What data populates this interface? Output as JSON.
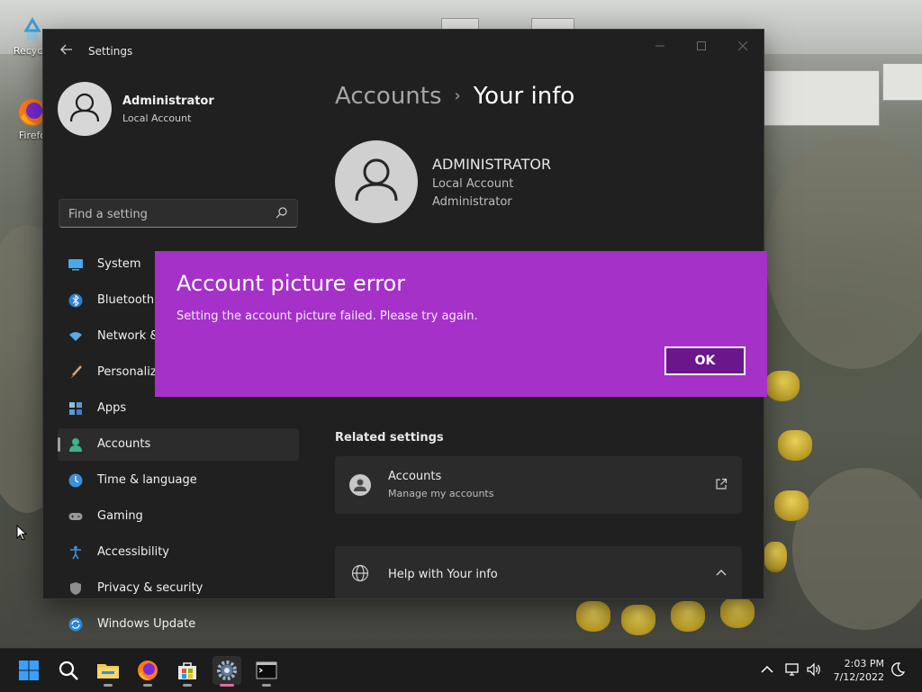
{
  "desktop": {
    "icons": [
      {
        "label": "Recycle",
        "icon": "recycle-bin-icon"
      },
      {
        "label": "Firefo",
        "icon": "firefox-icon"
      }
    ]
  },
  "window": {
    "title": "Settings",
    "back_icon": "back-arrow-icon",
    "controls": [
      "minimize-icon",
      "maximize-icon",
      "close-icon"
    ]
  },
  "sidebar": {
    "profile": {
      "name": "Administrator",
      "type": "Local Account"
    },
    "search_placeholder": "Find a setting",
    "items": [
      {
        "label": "System",
        "icon": "system-icon",
        "active": false
      },
      {
        "label": "Bluetooth",
        "icon": "bluetooth-icon",
        "active": false
      },
      {
        "label": "Network &",
        "icon": "network-icon",
        "active": false
      },
      {
        "label": "Personaliz",
        "icon": "personalization-brush-icon",
        "active": false
      },
      {
        "label": "Apps",
        "icon": "apps-icon",
        "active": false
      },
      {
        "label": "Accounts",
        "icon": "accounts-icon",
        "active": true
      },
      {
        "label": "Time & language",
        "icon": "time-language-icon",
        "active": false
      },
      {
        "label": "Gaming",
        "icon": "gaming-controller-icon",
        "active": false
      },
      {
        "label": "Accessibility",
        "icon": "accessibility-icon",
        "active": false
      },
      {
        "label": "Privacy & security",
        "icon": "shield-icon",
        "active": false
      },
      {
        "label": "Windows Update",
        "icon": "windows-update-icon",
        "active": false
      }
    ]
  },
  "main": {
    "breadcrumb": {
      "parent": "Accounts",
      "separator": "›",
      "current": "Your info"
    },
    "user": {
      "name": "ADMINISTRATOR",
      "account_type": "Local Account",
      "role": "Administrator"
    },
    "related_settings": {
      "title": "Related settings",
      "items": [
        {
          "title": "Accounts",
          "subtitle": "Manage my accounts",
          "icon": "external-link-icon"
        }
      ]
    },
    "help": {
      "title": "Help with Your info"
    }
  },
  "dialog": {
    "title": "Account picture error",
    "message": "Setting the account picture failed. Please try again.",
    "ok_label": "OK",
    "background": "#a531c8"
  },
  "taskbar": {
    "apps": [
      "start-icon",
      "search-icon",
      "file-explorer-icon",
      "firefox-icon",
      "microsoft-store-icon",
      "settings-gear-icon",
      "terminal-icon"
    ],
    "clock": {
      "time": "2:03 PM",
      "date": "7/12/2022"
    }
  }
}
